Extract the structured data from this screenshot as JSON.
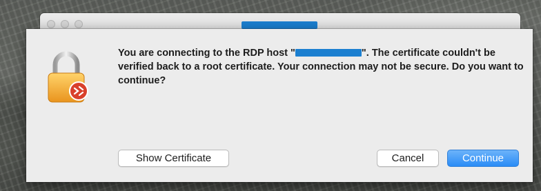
{
  "window": {
    "title": ""
  },
  "dialog": {
    "message_before_host": "You are connecting to the RDP host \"",
    "message_after_host": "\". The certificate couldn't be verified back to a root certificate. Your connection may not be secure. Do you want to continue?",
    "icon": "lock-with-remote-desktop-badge-icon"
  },
  "buttons": {
    "show_certificate": "Show Certificate",
    "cancel": "Cancel",
    "continue": "Continue"
  },
  "colors": {
    "primary_button": "#2a8cf6",
    "redaction": "#1b7fd0",
    "lock_body": "#f2a93b",
    "badge": "#d9402b"
  }
}
